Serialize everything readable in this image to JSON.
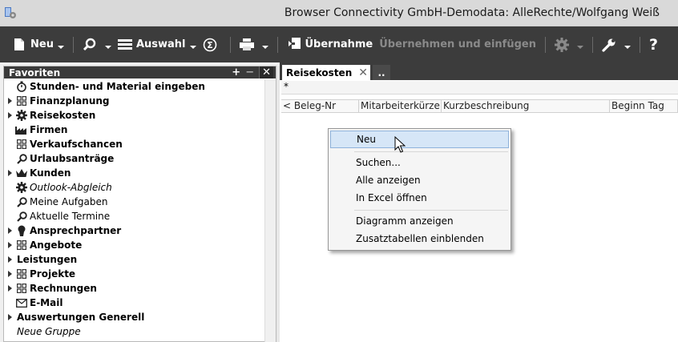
{
  "window": {
    "title": "Browser  Connectivity GmbH-Demodata: AlleRechte/Wolfgang Weiß"
  },
  "toolbar": {
    "neu_label": "Neu",
    "auswahl_label": "Auswahl",
    "uebernahme_label": "Übernahme",
    "uebernehmen_einfuegen_label": "Übernehmen und einfügen"
  },
  "favorites": {
    "header": "Favoriten",
    "items": [
      {
        "label": "Stunden- und Material eingeben",
        "icon": "stopwatch-icon",
        "bold": true,
        "expander": false
      },
      {
        "label": "Finanzplanung",
        "icon": "grid-icon",
        "bold": true,
        "expander": true
      },
      {
        "label": "Reisekosten",
        "icon": "gear-icon",
        "bold": true,
        "expander": true
      },
      {
        "label": "Firmen",
        "icon": "factory-icon",
        "bold": true,
        "expander": false
      },
      {
        "label": "Verkaufschancen",
        "icon": "grid-icon",
        "bold": true,
        "expander": false
      },
      {
        "label": "Urlaubsanträge",
        "icon": "search-icon",
        "bold": true,
        "expander": false
      },
      {
        "label": "Kunden",
        "icon": "crown-icon",
        "bold": true,
        "expander": true
      },
      {
        "label": "Outlook-Abgleich",
        "icon": "gear-icon",
        "bold": false,
        "italic": true,
        "expander": false
      },
      {
        "label": "Meine Aufgaben",
        "icon": "search-icon",
        "bold": false,
        "expander": false
      },
      {
        "label": "Aktuelle Termine",
        "icon": "search-icon",
        "bold": false,
        "expander": false
      },
      {
        "label": "Ansprechpartner",
        "icon": "person-icon",
        "bold": true,
        "expander": true
      },
      {
        "label": "Angebote",
        "icon": "grid-icon",
        "bold": true,
        "expander": true
      },
      {
        "label": "Leistungen",
        "icon": "",
        "bold": true,
        "expander": true
      },
      {
        "label": "Projekte",
        "icon": "grid-icon",
        "bold": true,
        "expander": true
      },
      {
        "label": "Rechnungen",
        "icon": "grid-icon",
        "bold": true,
        "expander": true
      },
      {
        "label": "E-Mail",
        "icon": "mail-icon",
        "bold": true,
        "expander": false
      },
      {
        "label": "Auswertungen Generell",
        "icon": "",
        "bold": true,
        "expander": true
      },
      {
        "label": "Neue Gruppe",
        "icon": "",
        "bold": false,
        "italic": true,
        "expander": false
      }
    ]
  },
  "tabs": {
    "active_label": "Reisekosten",
    "more_label": ".."
  },
  "grid": {
    "filter_value": "*",
    "columns": [
      "< Beleg-Nr",
      "Mitarbeiterkürzel",
      "Kurzbeschreibung",
      "Beginn Tag"
    ]
  },
  "context_menu": {
    "items": [
      "Neu",
      "Suchen...",
      "Alle anzeigen",
      "In Excel öffnen",
      "Diagramm anzeigen",
      "Zusatztabellen einblenden"
    ]
  }
}
